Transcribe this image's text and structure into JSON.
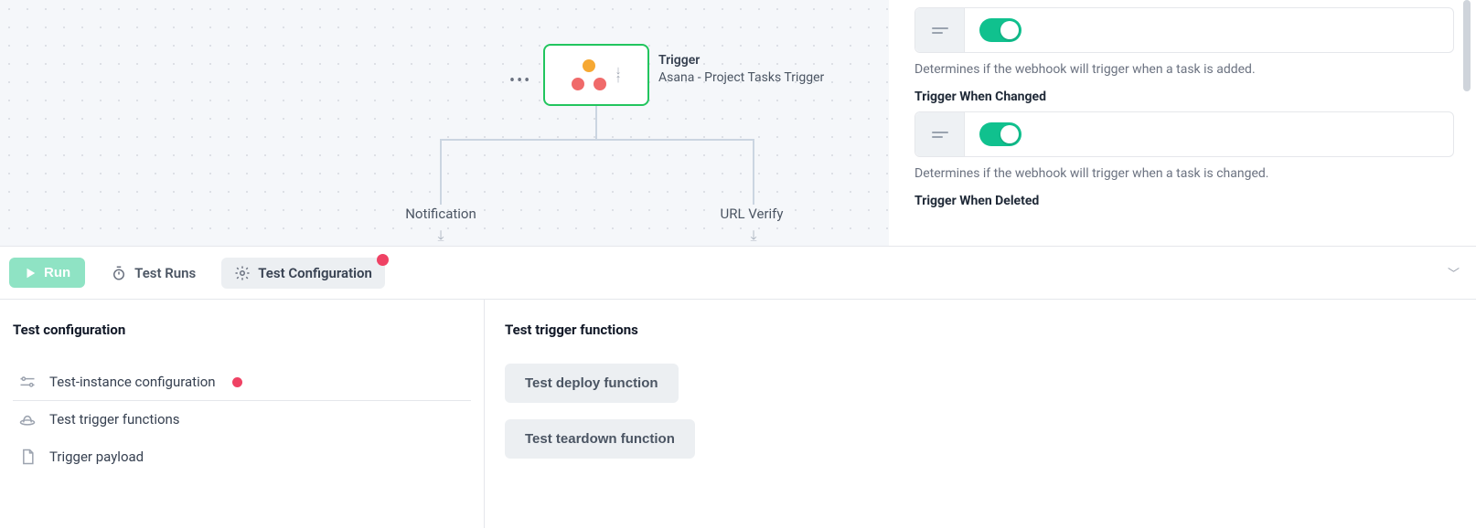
{
  "canvas": {
    "node": {
      "title": "Trigger",
      "subtitle": "Asana - Project Tasks Trigger"
    },
    "branches": {
      "left": "Notification",
      "right": "URL Verify"
    }
  },
  "config": {
    "groups": [
      {
        "help": "Determines if the webhook will trigger when a task is added."
      },
      {
        "heading": "Trigger When Changed",
        "help": "Determines if the webhook will trigger when a task is changed."
      },
      {
        "heading": "Trigger When Deleted"
      }
    ]
  },
  "toolbar": {
    "run": "Run",
    "tabs": {
      "runs": "Test Runs",
      "config": "Test Configuration"
    }
  },
  "leftPane": {
    "title": "Test configuration",
    "items": {
      "instance": "Test-instance configuration",
      "functions": "Test trigger functions",
      "payload": "Trigger payload"
    }
  },
  "rightPane": {
    "title": "Test trigger functions",
    "buttons": {
      "deploy": "Test deploy function",
      "teardown": "Test teardown function"
    }
  }
}
